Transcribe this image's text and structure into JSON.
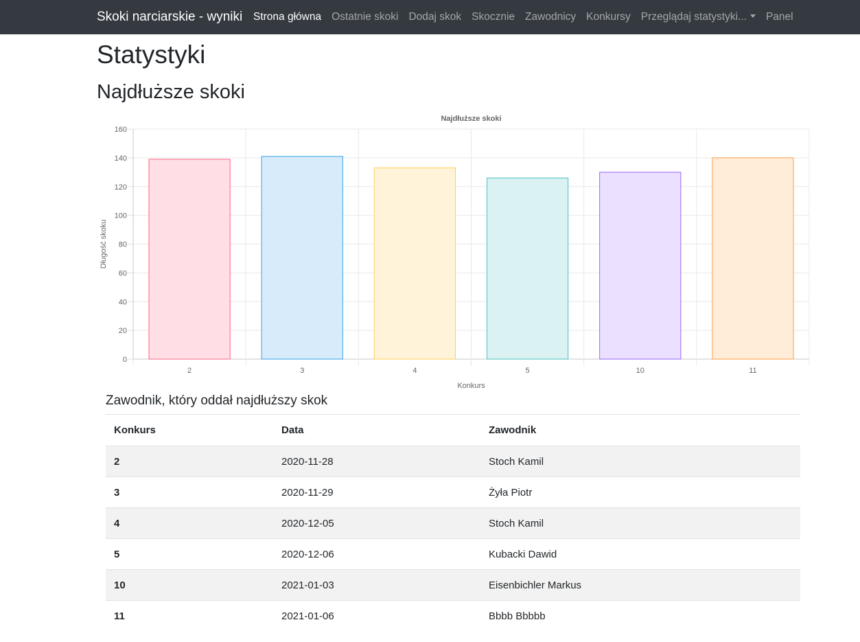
{
  "navbar": {
    "brand": "Skoki narciarskie - wyniki",
    "items": [
      {
        "label": "Strona główna",
        "active": true
      },
      {
        "label": "Ostatnie skoki",
        "active": false
      },
      {
        "label": "Dodaj skok",
        "active": false
      },
      {
        "label": "Skocznie",
        "active": false
      },
      {
        "label": "Zawodnicy",
        "active": false
      },
      {
        "label": "Konkursy",
        "active": false
      },
      {
        "label": "Przeglądaj statystyki...",
        "active": false,
        "dropdown": true
      },
      {
        "label": "Panel",
        "active": false
      }
    ]
  },
  "page": {
    "title": "Statystyki",
    "section_title": "Najdłuższe skoki",
    "table_title": "Zawodnik, który oddał najdłuższy skok"
  },
  "chart_data": {
    "type": "bar",
    "title": "Najdłuższe skoki",
    "xlabel": "Konkurs",
    "ylabel": "Długość skoku",
    "categories": [
      "2",
      "3",
      "4",
      "5",
      "10",
      "11"
    ],
    "values": [
      139,
      141,
      133,
      126,
      130,
      140
    ],
    "ylim": [
      0,
      160
    ],
    "yticks": [
      0,
      20,
      40,
      60,
      80,
      100,
      120,
      140,
      160
    ],
    "grid": true,
    "colors": {
      "fill": [
        "#ffdfe5",
        "#d7ebfa",
        "#fff4da",
        "#dbf2f2",
        "#ebe0ff",
        "#ffecd9"
      ],
      "stroke": [
        "#ff6384",
        "#36a2eb",
        "#ffcd56",
        "#4bc0c0",
        "#9966ff",
        "#ff9f40"
      ]
    }
  },
  "table": {
    "headers": [
      "Konkurs",
      "Data",
      "Zawodnik"
    ],
    "rows": [
      [
        "2",
        "2020-11-28",
        "Stoch Kamil"
      ],
      [
        "3",
        "2020-11-29",
        "Żyła Piotr"
      ],
      [
        "4",
        "2020-12-05",
        "Stoch Kamil"
      ],
      [
        "5",
        "2020-12-06",
        "Kubacki Dawid"
      ],
      [
        "10",
        "2021-01-03",
        "Eisenbichler Markus"
      ],
      [
        "11",
        "2021-01-06",
        "Bbbb Bbbbb"
      ]
    ]
  }
}
